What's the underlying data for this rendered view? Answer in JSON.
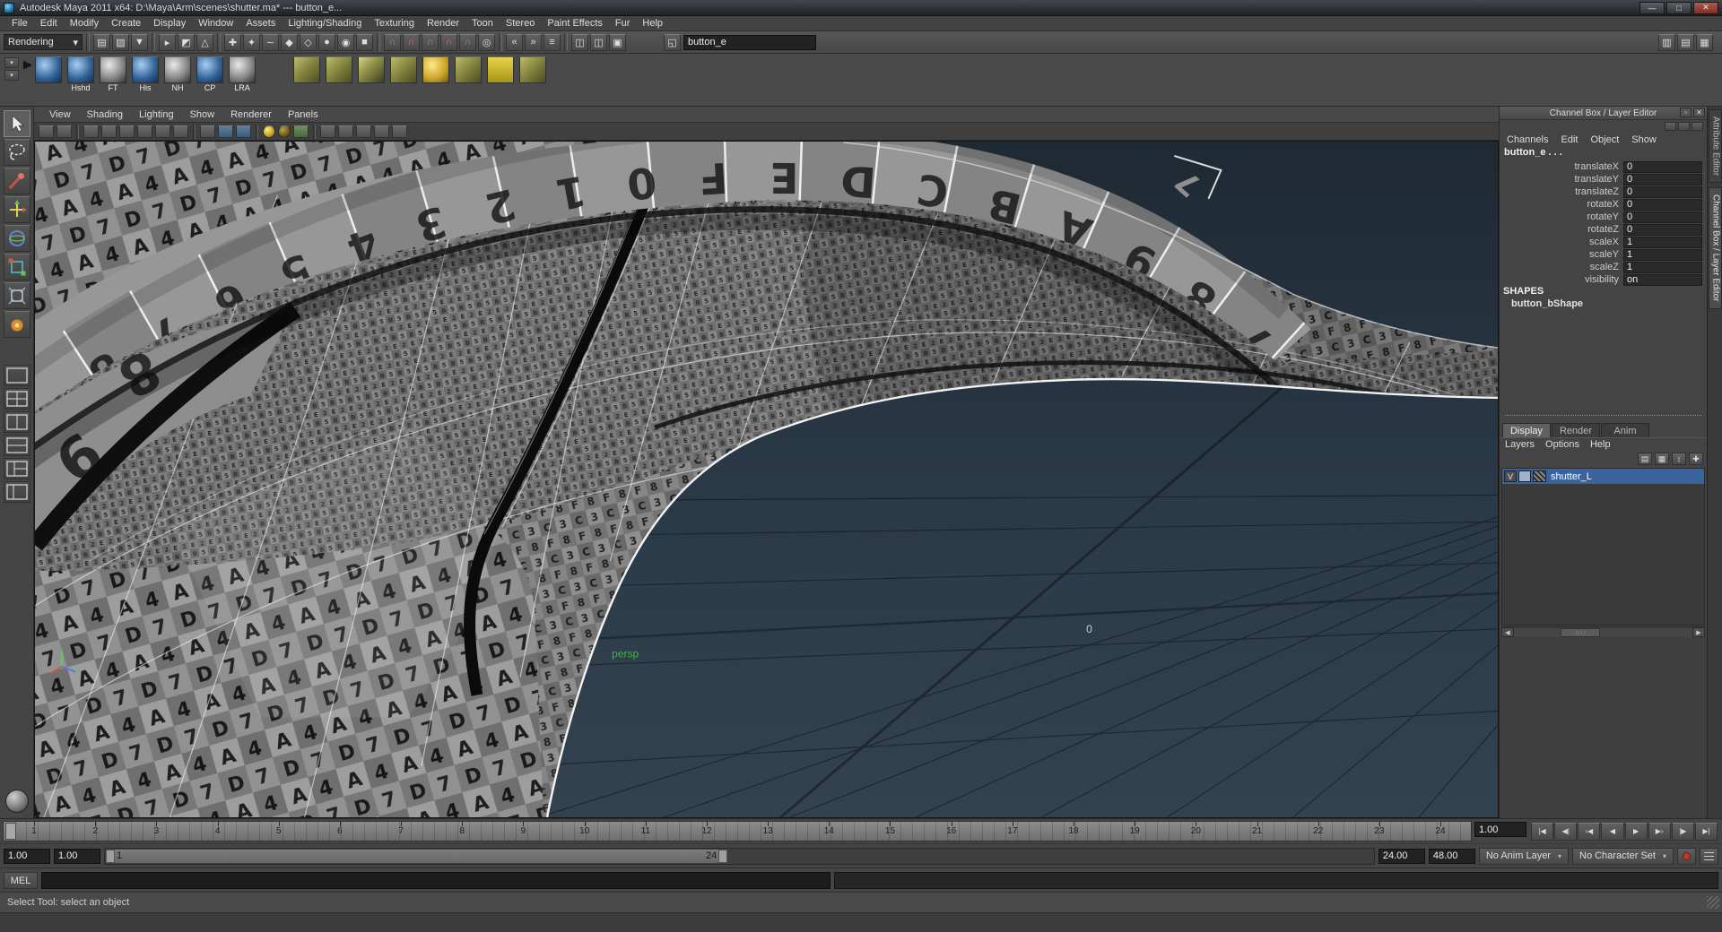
{
  "window": {
    "title": "Autodesk Maya 2011 x64: D:\\Maya\\Arm\\scenes\\shutter.ma*   ---   button_e...",
    "minimize_glyph": "—",
    "maximize_glyph": "□",
    "close_glyph": "✕"
  },
  "menu_bar": {
    "items": [
      "File",
      "Edit",
      "Modify",
      "Create",
      "Display",
      "Window",
      "Assets",
      "Lighting/Shading",
      "Texturing",
      "Render",
      "Toon",
      "Stereo",
      "Paint Effects",
      "Fur",
      "Help"
    ]
  },
  "status_line": {
    "menu_set": "Rendering",
    "dropdown_arrow": "▾",
    "icons": [
      {
        "k": "ic",
        "n": "file-new-icon",
        "g": "▤",
        "i": "true"
      },
      {
        "k": "ic",
        "n": "file-open-icon",
        "g": "▨",
        "i": "true"
      },
      {
        "k": "ic",
        "n": "file-save-icon",
        "g": "▼",
        "i": "true"
      },
      {
        "k": "sep",
        "n": "separator",
        "g": "",
        "i": "false"
      },
      {
        "k": "ic",
        "n": "select-hierarchy-icon",
        "g": "▸",
        "i": "true"
      },
      {
        "k": "ic",
        "n": "select-object-icon",
        "g": "◩",
        "i": "true"
      },
      {
        "k": "ic",
        "n": "select-component-icon",
        "g": "△",
        "i": "true"
      },
      {
        "k": "sep",
        "n": "separator",
        "g": "",
        "i": "false"
      },
      {
        "k": "ic",
        "n": "select-handles-icon",
        "g": "✚",
        "i": "true"
      },
      {
        "k": "ic",
        "n": "select-joints-icon",
        "g": "✦",
        "i": "true"
      },
      {
        "k": "ic",
        "n": "select-curves-icon",
        "g": "∼",
        "i": "true"
      },
      {
        "k": "ic",
        "n": "select-surfaces-icon",
        "g": "◆",
        "i": "true"
      },
      {
        "k": "ic",
        "n": "select-deformations-icon",
        "g": "◇",
        "i": "true"
      },
      {
        "k": "ic",
        "n": "select-dynamics-icon",
        "g": "●",
        "i": "true"
      },
      {
        "k": "ic",
        "n": "select-rendering-icon",
        "g": "◉",
        "i": "true"
      },
      {
        "k": "ic",
        "n": "select-misc-icon",
        "g": "■",
        "i": "true"
      },
      {
        "k": "sep",
        "n": "separator",
        "g": "",
        "i": "false"
      },
      {
        "k": "ic mag",
        "n": "snap-to-grids-icon",
        "g": "∩",
        "i": "true"
      },
      {
        "k": "ic mag",
        "n": "snap-to-curves-icon",
        "g": "∩",
        "i": "true"
      },
      {
        "k": "ic mag",
        "n": "snap-to-points-icon",
        "g": "∩",
        "i": "true"
      },
      {
        "k": "ic mag",
        "n": "snap-to-projected-center-icon",
        "g": "∩",
        "i": "true"
      },
      {
        "k": "ic mag",
        "n": "snap-to-view-planes-icon",
        "g": "∩",
        "i": "true"
      },
      {
        "k": "ic",
        "n": "make-live-icon",
        "g": "◎",
        "i": "true"
      },
      {
        "k": "sep",
        "n": "separator",
        "g": "",
        "i": "false"
      },
      {
        "k": "ic",
        "n": "input-connections-icon",
        "g": "«",
        "i": "true"
      },
      {
        "k": "ic",
        "n": "output-connections-icon",
        "g": "»",
        "i": "true"
      },
      {
        "k": "ic",
        "n": "construction-history-icon",
        "g": "≡",
        "i": "true"
      },
      {
        "k": "sep",
        "n": "separator",
        "g": "",
        "i": "false"
      },
      {
        "k": "ic",
        "n": "render-current-frame-icon",
        "g": "◫",
        "i": "true"
      },
      {
        "k": "ic",
        "n": "ipr-render-icon",
        "g": "◫",
        "i": "true"
      },
      {
        "k": "ic",
        "n": "render-settings-icon",
        "g": "▣",
        "i": "true"
      }
    ],
    "selection_input": "button_e",
    "right_icons": [
      {
        "k": "ic",
        "n": "toggle-attribute-editor-icon",
        "g": "▥",
        "i": "true"
      },
      {
        "k": "ic",
        "n": "toggle-tool-settings-icon",
        "g": "▤",
        "i": "true"
      },
      {
        "k": "ic",
        "n": "toggle-channel-box-icon",
        "g": "▦",
        "i": "true"
      }
    ]
  },
  "shelf": {
    "tab_selector_glyph": "▾",
    "menu_glyph": "▾",
    "arrow_glyph": "▶",
    "items": [
      {
        "label": "",
        "kind": "sphere-blue"
      },
      {
        "label": "Hshd",
        "kind": "sphere-blue"
      },
      {
        "label": "FT",
        "kind": "sphere-shaded"
      },
      {
        "label": "His",
        "kind": "sphere-blue"
      },
      {
        "label": "NH",
        "kind": "sphere-shaded"
      },
      {
        "label": "CP",
        "kind": "sphere-blue"
      },
      {
        "label": "LRA",
        "kind": "sphere-shaded"
      },
      {
        "label": "",
        "kind": "spacer"
      },
      {
        "label": "",
        "kind": "cube-olive"
      },
      {
        "label": "",
        "kind": "cube-olive"
      },
      {
        "label": "",
        "kind": "cube-stack"
      },
      {
        "label": "",
        "kind": "cube-olive"
      },
      {
        "label": "",
        "kind": "sphere-yellow"
      },
      {
        "label": "",
        "kind": "cube-olive"
      },
      {
        "label": "",
        "kind": "plane-yellow"
      },
      {
        "label": "",
        "kind": "cube-olive"
      }
    ]
  },
  "toolbox": {
    "tools": [
      "select-tool",
      "lasso-tool",
      "paint-select-tool",
      "move-tool",
      "rotate-tool",
      "scale-tool",
      "universal-manipulator-tool",
      "soft-modification-tool"
    ],
    "layouts": [
      "single-pane-layout",
      "four-pane-layout",
      "two-pane-side-layout",
      "two-pane-stacked-layout",
      "three-pane-layout",
      "outliner-persp-layout"
    ]
  },
  "panel": {
    "menus": [
      "View",
      "Shading",
      "Lighting",
      "Show",
      "Renderer",
      "Panels"
    ],
    "camera_label": "persp",
    "grid_origin_label": "0",
    "rim_characters": "789ABCDEF0123456789",
    "wall_character_1": "8",
    "wall_character_2": "9",
    "fragment_character": "7"
  },
  "channel_box": {
    "panel_title": "Channel Box / Layer Editor",
    "panel_buttons": [
      {
        "n": "float-panel-button",
        "g": "▫"
      },
      {
        "n": "close-panel-button",
        "g": "✕"
      }
    ],
    "menus": [
      "Channels",
      "Edit",
      "Object",
      "Show"
    ],
    "object_name": "button_e . . .",
    "attributes": [
      {
        "name": "translateX",
        "value": "0"
      },
      {
        "name": "translateY",
        "value": "0"
      },
      {
        "name": "translateZ",
        "value": "0"
      },
      {
        "name": "rotateX",
        "value": "0"
      },
      {
        "name": "rotateY",
        "value": "0"
      },
      {
        "name": "rotateZ",
        "value": "0"
      },
      {
        "name": "scaleX",
        "value": "1"
      },
      {
        "name": "scaleY",
        "value": "1"
      },
      {
        "name": "scaleZ",
        "value": "1"
      },
      {
        "name": "visibility",
        "value": "on"
      }
    ],
    "shapes_header": "SHAPES",
    "shape_name": "button_bShape"
  },
  "layer_editor": {
    "tabs": [
      {
        "label": "Display",
        "state": "active"
      },
      {
        "label": "Render",
        "state": ""
      },
      {
        "label": "Anim",
        "state": ""
      }
    ],
    "menus": [
      "Layers",
      "Options",
      "Help"
    ],
    "buttons": [
      {
        "n": "new-empty-layer-button",
        "g": "▤"
      },
      {
        "n": "new-layer-from-selected-button",
        "g": "▦"
      },
      {
        "n": "sort-layers-button",
        "g": "↕"
      },
      {
        "n": "layer-options-button",
        "g": "✚"
      }
    ],
    "layers": [
      {
        "visibility": "V",
        "name": "shutter_L"
      }
    ],
    "scroll_left_glyph": "◀",
    "scroll_right_glyph": "▶"
  },
  "right_tabs": [
    {
      "label": "Attribute Editor",
      "state": ""
    },
    {
      "label": "Channel Box / Layer Editor",
      "state": "active"
    }
  ],
  "time_slider": {
    "ticks": [
      "1",
      "2",
      "3",
      "4",
      "5",
      "6",
      "7",
      "8",
      "9",
      "10",
      "11",
      "12",
      "13",
      "14",
      "15",
      "16",
      "17",
      "18",
      "19",
      "20",
      "21",
      "22",
      "23",
      "24"
    ],
    "current_time": "1.00",
    "playback_buttons": [
      {
        "name": "go-to-start-button",
        "glyph": "|◀"
      },
      {
        "name": "step-back-frame-button",
        "glyph": "◀|"
      },
      {
        "name": "step-back-key-button",
        "glyph": "‹◀"
      },
      {
        "name": "play-backwards-button",
        "glyph": "◀"
      },
      {
        "name": "play-forwards-button",
        "glyph": "▶"
      },
      {
        "name": "step-forward-key-button",
        "glyph": "▶›"
      },
      {
        "name": "step-forward-frame-button",
        "glyph": "|▶"
      },
      {
        "name": "go-to-end-button",
        "glyph": "▶|"
      }
    ]
  },
  "range_slider": {
    "animation_start": "1.00",
    "playback_start": "1.00",
    "range_bar_start_label": "1",
    "range_bar_end_label": "24",
    "playback_end": "24.00",
    "animation_end": "48.00",
    "anim_layer": "No Anim Layer",
    "character_set": "No Character Set",
    "dropdown_arrow": "▾"
  },
  "command_line": {
    "label": "MEL"
  },
  "help_line": {
    "text": "Select Tool: select an object"
  }
}
